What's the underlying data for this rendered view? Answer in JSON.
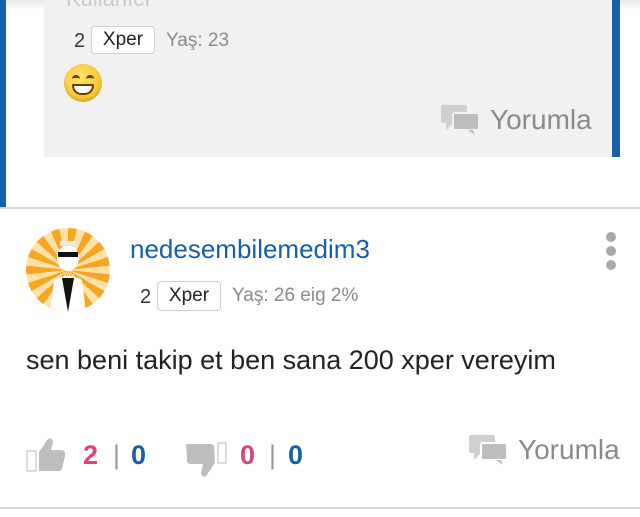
{
  "reply": {
    "xp_count": "2",
    "xp_label": "Xper",
    "age": "Yaş: 23",
    "comment_label": "Yorumla",
    "cut_text": "Kullanıcı"
  },
  "post": {
    "username": "nedesembilemedim3",
    "xp_count": "2",
    "xp_label": "Xper",
    "meta": "Yaş: 26 eig 2%",
    "text": "sen beni takip et ben sana 200 xper vereyim",
    "likes_pink": "2",
    "likes_blue": "0",
    "dislikes_pink": "0",
    "dislikes_blue": "0",
    "separator": "|",
    "comment_label": "Yorumla"
  },
  "colors": {
    "accent": "#1660a8",
    "pink": "#d6457f",
    "gray": "#8a8a8a"
  },
  "icons": [
    "grin-emoji-icon",
    "comment-icon",
    "thumbs-up-icon",
    "thumbs-down-icon",
    "more-vertical-icon"
  ]
}
